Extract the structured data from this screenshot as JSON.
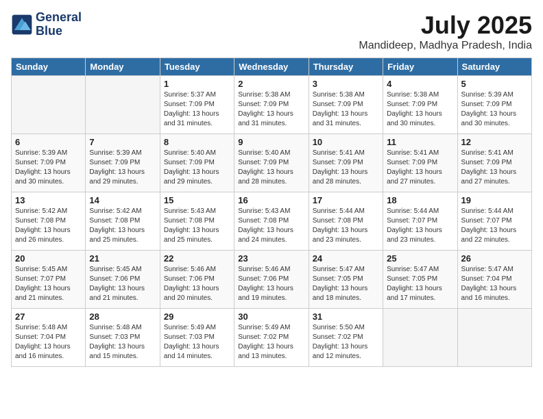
{
  "header": {
    "logo_line1": "General",
    "logo_line2": "Blue",
    "month": "July 2025",
    "location": "Mandideep, Madhya Pradesh, India"
  },
  "weekdays": [
    "Sunday",
    "Monday",
    "Tuesday",
    "Wednesday",
    "Thursday",
    "Friday",
    "Saturday"
  ],
  "weeks": [
    [
      {
        "day": "",
        "detail": ""
      },
      {
        "day": "",
        "detail": ""
      },
      {
        "day": "1",
        "detail": "Sunrise: 5:37 AM\nSunset: 7:09 PM\nDaylight: 13 hours and 31 minutes."
      },
      {
        "day": "2",
        "detail": "Sunrise: 5:38 AM\nSunset: 7:09 PM\nDaylight: 13 hours and 31 minutes."
      },
      {
        "day": "3",
        "detail": "Sunrise: 5:38 AM\nSunset: 7:09 PM\nDaylight: 13 hours and 31 minutes."
      },
      {
        "day": "4",
        "detail": "Sunrise: 5:38 AM\nSunset: 7:09 PM\nDaylight: 13 hours and 30 minutes."
      },
      {
        "day": "5",
        "detail": "Sunrise: 5:39 AM\nSunset: 7:09 PM\nDaylight: 13 hours and 30 minutes."
      }
    ],
    [
      {
        "day": "6",
        "detail": "Sunrise: 5:39 AM\nSunset: 7:09 PM\nDaylight: 13 hours and 30 minutes."
      },
      {
        "day": "7",
        "detail": "Sunrise: 5:39 AM\nSunset: 7:09 PM\nDaylight: 13 hours and 29 minutes."
      },
      {
        "day": "8",
        "detail": "Sunrise: 5:40 AM\nSunset: 7:09 PM\nDaylight: 13 hours and 29 minutes."
      },
      {
        "day": "9",
        "detail": "Sunrise: 5:40 AM\nSunset: 7:09 PM\nDaylight: 13 hours and 28 minutes."
      },
      {
        "day": "10",
        "detail": "Sunrise: 5:41 AM\nSunset: 7:09 PM\nDaylight: 13 hours and 28 minutes."
      },
      {
        "day": "11",
        "detail": "Sunrise: 5:41 AM\nSunset: 7:09 PM\nDaylight: 13 hours and 27 minutes."
      },
      {
        "day": "12",
        "detail": "Sunrise: 5:41 AM\nSunset: 7:09 PM\nDaylight: 13 hours and 27 minutes."
      }
    ],
    [
      {
        "day": "13",
        "detail": "Sunrise: 5:42 AM\nSunset: 7:08 PM\nDaylight: 13 hours and 26 minutes."
      },
      {
        "day": "14",
        "detail": "Sunrise: 5:42 AM\nSunset: 7:08 PM\nDaylight: 13 hours and 25 minutes."
      },
      {
        "day": "15",
        "detail": "Sunrise: 5:43 AM\nSunset: 7:08 PM\nDaylight: 13 hours and 25 minutes."
      },
      {
        "day": "16",
        "detail": "Sunrise: 5:43 AM\nSunset: 7:08 PM\nDaylight: 13 hours and 24 minutes."
      },
      {
        "day": "17",
        "detail": "Sunrise: 5:44 AM\nSunset: 7:08 PM\nDaylight: 13 hours and 23 minutes."
      },
      {
        "day": "18",
        "detail": "Sunrise: 5:44 AM\nSunset: 7:07 PM\nDaylight: 13 hours and 23 minutes."
      },
      {
        "day": "19",
        "detail": "Sunrise: 5:44 AM\nSunset: 7:07 PM\nDaylight: 13 hours and 22 minutes."
      }
    ],
    [
      {
        "day": "20",
        "detail": "Sunrise: 5:45 AM\nSunset: 7:07 PM\nDaylight: 13 hours and 21 minutes."
      },
      {
        "day": "21",
        "detail": "Sunrise: 5:45 AM\nSunset: 7:06 PM\nDaylight: 13 hours and 21 minutes."
      },
      {
        "day": "22",
        "detail": "Sunrise: 5:46 AM\nSunset: 7:06 PM\nDaylight: 13 hours and 20 minutes."
      },
      {
        "day": "23",
        "detail": "Sunrise: 5:46 AM\nSunset: 7:06 PM\nDaylight: 13 hours and 19 minutes."
      },
      {
        "day": "24",
        "detail": "Sunrise: 5:47 AM\nSunset: 7:05 PM\nDaylight: 13 hours and 18 minutes."
      },
      {
        "day": "25",
        "detail": "Sunrise: 5:47 AM\nSunset: 7:05 PM\nDaylight: 13 hours and 17 minutes."
      },
      {
        "day": "26",
        "detail": "Sunrise: 5:47 AM\nSunset: 7:04 PM\nDaylight: 13 hours and 16 minutes."
      }
    ],
    [
      {
        "day": "27",
        "detail": "Sunrise: 5:48 AM\nSunset: 7:04 PM\nDaylight: 13 hours and 16 minutes."
      },
      {
        "day": "28",
        "detail": "Sunrise: 5:48 AM\nSunset: 7:03 PM\nDaylight: 13 hours and 15 minutes."
      },
      {
        "day": "29",
        "detail": "Sunrise: 5:49 AM\nSunset: 7:03 PM\nDaylight: 13 hours and 14 minutes."
      },
      {
        "day": "30",
        "detail": "Sunrise: 5:49 AM\nSunset: 7:02 PM\nDaylight: 13 hours and 13 minutes."
      },
      {
        "day": "31",
        "detail": "Sunrise: 5:50 AM\nSunset: 7:02 PM\nDaylight: 13 hours and 12 minutes."
      },
      {
        "day": "",
        "detail": ""
      },
      {
        "day": "",
        "detail": ""
      }
    ]
  ]
}
